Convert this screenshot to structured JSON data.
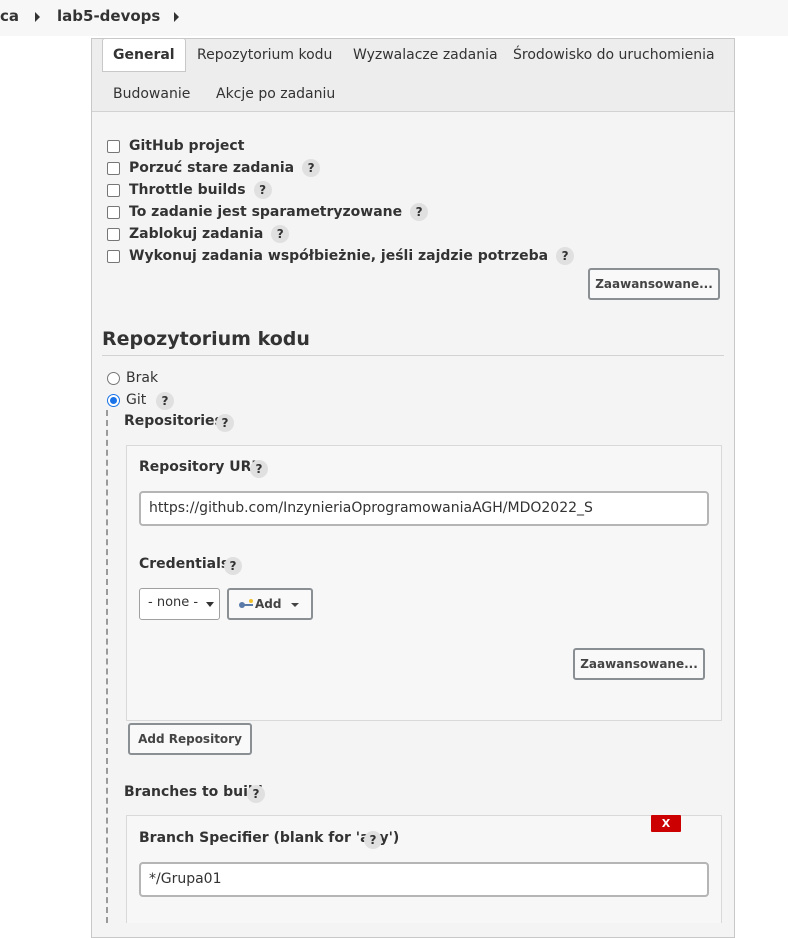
{
  "breadcrumb": {
    "items": [
      "ca",
      "lab5-devops"
    ]
  },
  "tabs": [
    "General",
    "Repozytorium kodu",
    "Wyzwalacze zadania",
    "Środowisko do uruchomienia",
    "Budowanie",
    "Akcje po zadaniu"
  ],
  "general": {
    "options": [
      {
        "label": "GitHub project",
        "help": false
      },
      {
        "label": "Porzuć stare zadania",
        "help": true
      },
      {
        "label": "Throttle builds",
        "help": true
      },
      {
        "label": "To zadanie jest sparametryzowane",
        "help": true
      },
      {
        "label": "Zablokuj zadania",
        "help": true
      },
      {
        "label": "Wykonuj zadania współbieżnie, jeśli zajdzie potrzeba",
        "help": true
      }
    ],
    "advanced_label": "Zaawansowane..."
  },
  "help_glyph": "?",
  "scm": {
    "title": "Repozytorium kodu",
    "none_label": "Brak",
    "git_label": "Git",
    "selected": "Git",
    "repositories_label": "Repositories",
    "repo_url_label": "Repository URL",
    "repo_url_value": "https://github.com/InzynieriaOprogramowaniaAGH/MDO2022_S",
    "credentials_label": "Credentials",
    "credentials_selected": "- none -",
    "add_label": "Add",
    "advanced_label": "Zaawansowane...",
    "add_repository_label": "Add Repository",
    "branches_label": "Branches to build",
    "branch_specifier_label": "Branch Specifier (blank for 'any')",
    "branch_specifier_value": "*/Grupa01",
    "delete_label": "X"
  }
}
